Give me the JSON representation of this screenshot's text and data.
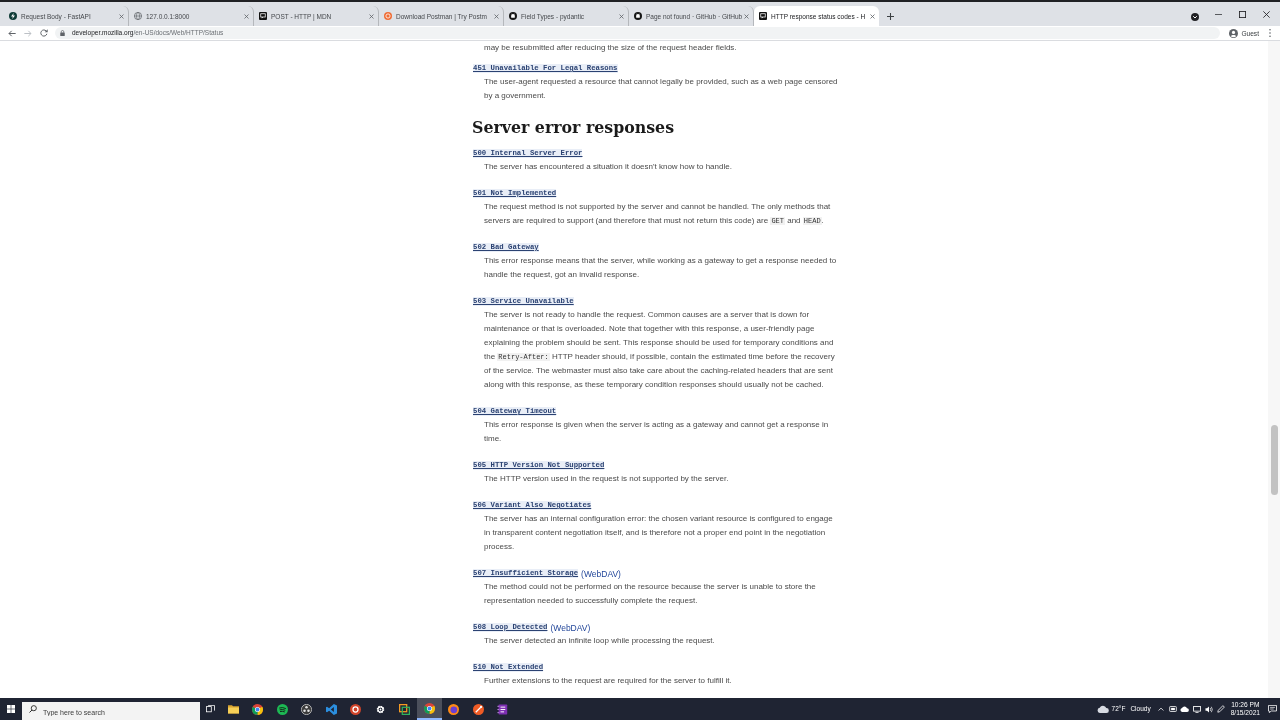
{
  "browser": {
    "tabs": [
      {
        "title": "Request Body - FastAPI",
        "selected": false
      },
      {
        "title": "127.0.0.1:8000",
        "selected": false
      },
      {
        "title": "POST - HTTP | MDN",
        "selected": false
      },
      {
        "title": "Download Postman | Try Postm",
        "selected": false
      },
      {
        "title": "Field Types - pydantic",
        "selected": false
      },
      {
        "title": "Page not found · GitHub · GitHub",
        "selected": false
      },
      {
        "title": "HTTP response status codes - H",
        "selected": true
      }
    ],
    "back_button": {
      "disabled": false
    },
    "forward_button": {
      "disabled": true
    },
    "address_bar": {
      "host": "developer.mozilla.org",
      "path": "/en-US/docs/Web/HTTP/Status"
    },
    "profile": {
      "label": "Guest"
    }
  },
  "page": {
    "cut_off_text": "may be resubmitted after reducing the size of the request header fields.",
    "entries_above": [
      {
        "title": "451 Unavailable For Legal Reasons",
        "description": [
          {
            "kind": "text",
            "text": "The user-agent requested a resource that cannot legally be provided, such as a web page censored by a government."
          }
        ]
      }
    ],
    "section": {
      "heading": "Server error responses",
      "entries": [
        {
          "title": "500 Internal Server Error",
          "description": [
            {
              "kind": "text",
              "text": "The server has encountered a situation it doesn't know how to handle."
            }
          ]
        },
        {
          "title": "501 Not Implemented",
          "description": [
            {
              "kind": "text",
              "text": "The request method is not supported by the server and cannot be handled. The only methods that servers are required to support (and therefore that must not return this code) are "
            },
            {
              "kind": "code",
              "text": "GET"
            },
            {
              "kind": "text",
              "text": " and "
            },
            {
              "kind": "code",
              "text": "HEAD"
            },
            {
              "kind": "text",
              "text": "."
            }
          ]
        },
        {
          "title": "502 Bad Gateway",
          "description": [
            {
              "kind": "text",
              "text": "This error response means that the server, while working as a gateway to get a response needed to handle the request, got an invalid response."
            }
          ]
        },
        {
          "title": "503 Service Unavailable",
          "description": [
            {
              "kind": "text",
              "text": "The server is not ready to handle the request. Common causes are a server that is down for maintenance or that is overloaded. Note that together with this response, a user-friendly page explaining the problem should be sent. This response should be used for temporary conditions and the "
            },
            {
              "kind": "code",
              "text": "Retry-After:"
            },
            {
              "kind": "text",
              "text": " HTTP header should, if possible, contain the estimated time before the recovery of the service. The webmaster must also take care about the caching-related headers that are sent along with this response, as these temporary condition responses should usually not be cached."
            }
          ]
        },
        {
          "title": "504 Gateway Timeout",
          "description": [
            {
              "kind": "text",
              "text": "This error response is given when the server is acting as a gateway and cannot get a response in time."
            }
          ]
        },
        {
          "title": "505 HTTP Version Not Supported",
          "description": [
            {
              "kind": "text",
              "text": "The HTTP version used in the request is not supported by the server."
            }
          ]
        },
        {
          "title": "506 Variant Also Negotiates",
          "description": [
            {
              "kind": "text",
              "text": "The server has an internal configuration error: the chosen variant resource is configured to engage in transparent content negotiation itself, and is therefore not a proper end point in the negotiation process."
            }
          ]
        },
        {
          "title": "507 Insufficient Storage",
          "tag": "(WebDAV)",
          "description": [
            {
              "kind": "text",
              "text": "The method could not be performed on the resource because the server is unable to store the representation needed to successfully complete the request."
            }
          ]
        },
        {
          "title": "508 Loop Detected",
          "tag": "(WebDAV)",
          "description": [
            {
              "kind": "text",
              "text": "The server detected an infinite loop while processing the request."
            }
          ]
        },
        {
          "title": "510 Not Extended",
          "description": [
            {
              "kind": "text",
              "text": "Further extensions to the request are required for the server to fulfill it."
            }
          ]
        }
      ]
    }
  },
  "taskbar": {
    "search": {
      "placeholder": "Type here to search"
    },
    "apps": [
      {
        "selected": false
      },
      {
        "selected": false
      },
      {
        "selected": false
      },
      {
        "selected": false
      },
      {
        "selected": false
      },
      {
        "selected": false
      },
      {
        "selected": false
      },
      {
        "selected": false
      },
      {
        "selected": true
      },
      {
        "selected": false
      },
      {
        "selected": false
      },
      {
        "selected": false
      }
    ],
    "weather": {
      "temperature": "72°F",
      "condition": "Cloudy"
    },
    "clock": {
      "time": "10:26 PM",
      "date": "8/15/2021"
    }
  }
}
